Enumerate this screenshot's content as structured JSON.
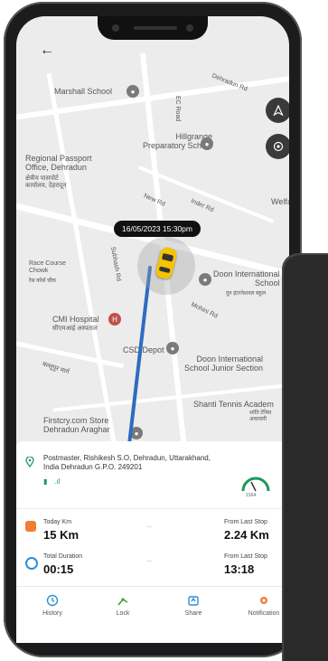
{
  "map": {
    "labels": {
      "marshall": "Marshall School",
      "ec_road": "EC Road",
      "dehradun_rd": "Dehradun Rd",
      "hillgrange": "Hillgrange\nPreparatory School",
      "passport": "Regional Passport\nOffice, Dehradun",
      "passport_hindi": "क्षेत्रीय पासपोर्ट\nकार्यालय, देहरादून",
      "new_rd": "New Rd",
      "inder_rd": "Inder Rd",
      "welfare": "Welfa",
      "subhash": "Subhash Rd",
      "race_course": "Race Course\nChowk",
      "race_course_hindi": "रेस कोर्स चौक",
      "mohini": "Mohini Rd",
      "doon_intl": "Doon International\nSchool",
      "doon_intl_hindi": "दून इंटरनेशनल स्कूल",
      "cmi": "CMI Hospital",
      "cmi_hindi": "सीएमआई अस्पताल",
      "csd": "CSD Depot",
      "doon_jr": "Doon International\nSchool Junior Section",
      "shanti": "Shanti Tennis Academ",
      "shanti_hindi": "शांति टेनिस अकादमी",
      "firstcry": "Firstcry.com Store\nDehradun Araghar",
      "side_hindi": "बल्लूपुर मार्ग"
    },
    "timestamp": "16/05/2023 15:30pm",
    "colors": {
      "route": "#2d6cc0",
      "car": "#f5c400"
    }
  },
  "card": {
    "address": "Postmaster, Rishikesh S.O, Dehradun, Uttarakhand,\nIndia Dehradun G.P.O. 249201",
    "status_battery": "▮",
    "status_signal": ".ıl",
    "speed_value": "2164",
    "today_km_label": "Today Km",
    "today_km_value": "15 Km",
    "from_last_stop_label": "From Last Stop",
    "from_last_stop_value": "2.24 Km",
    "total_duration_label": "Total Duration",
    "total_duration_value": "00:15",
    "from_last_stop_label2": "From Last Stop",
    "from_last_stop_value2": "13:18"
  },
  "nav": {
    "history": "History",
    "lock": "Lock",
    "share": "Share",
    "notification": "Notification"
  }
}
